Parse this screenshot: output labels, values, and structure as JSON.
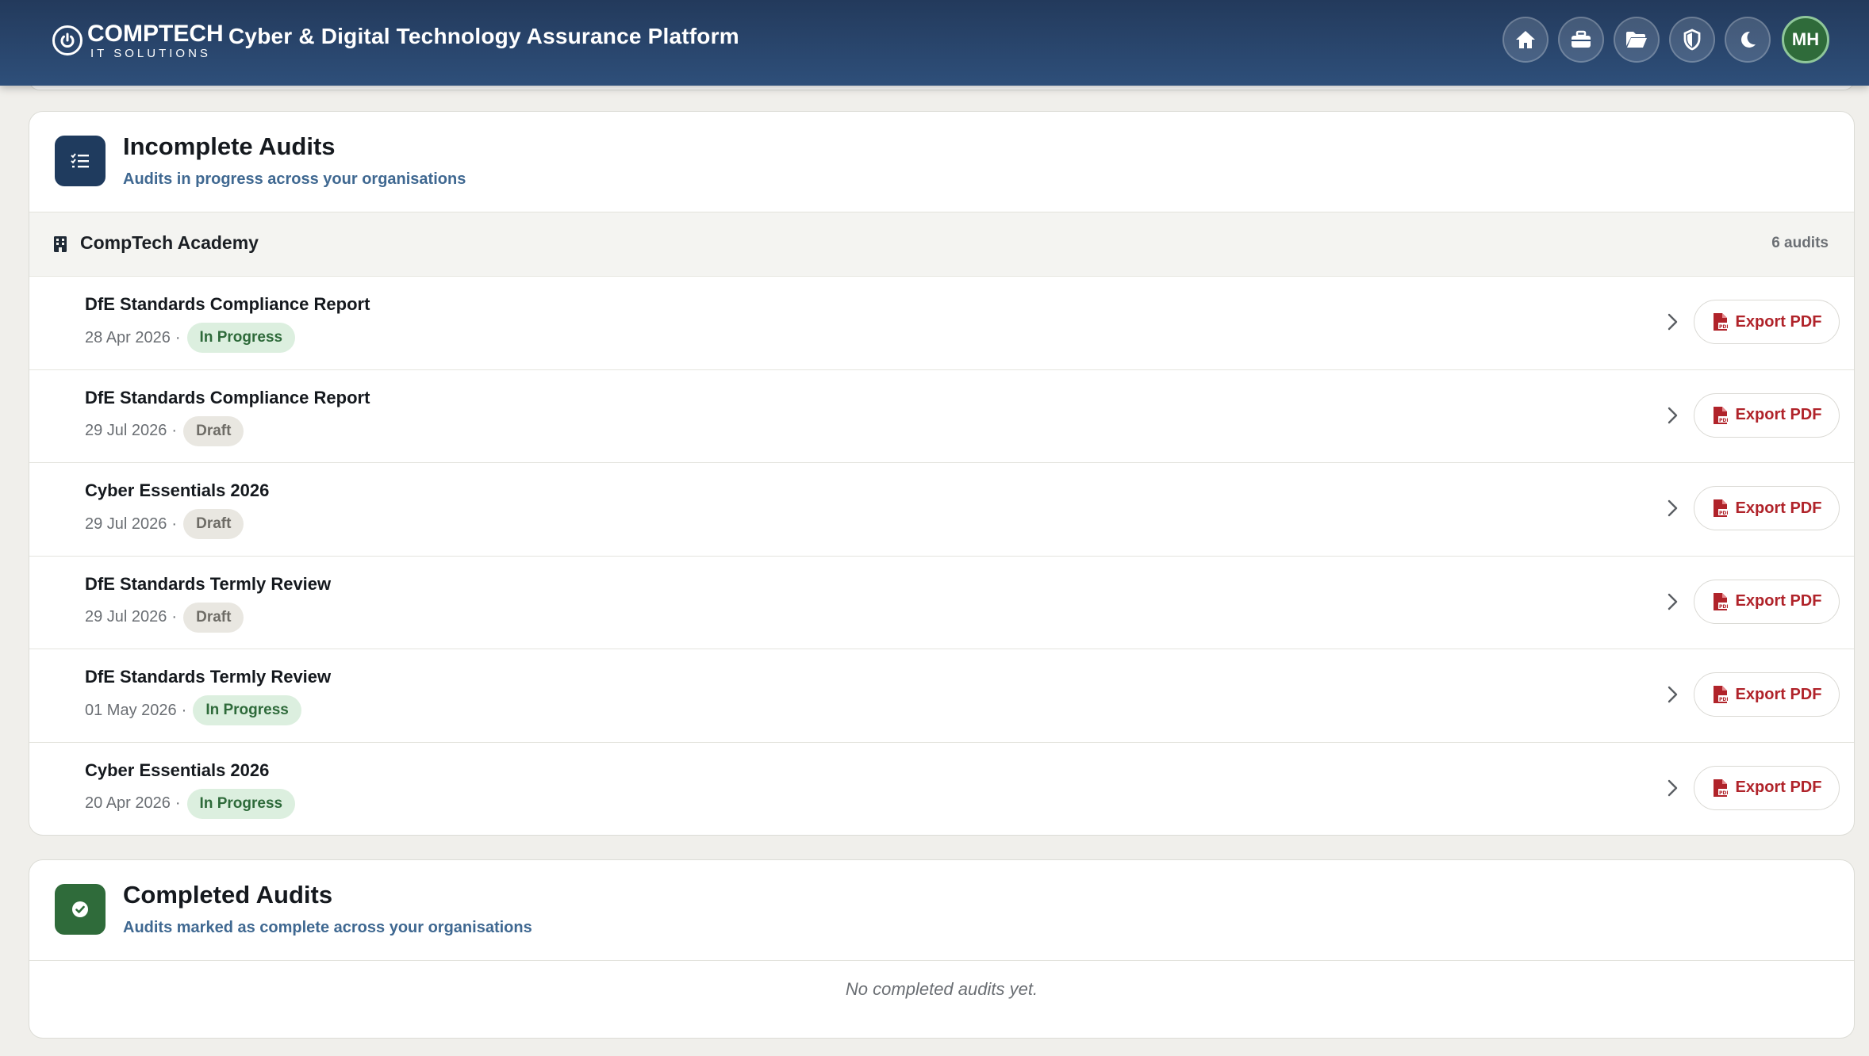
{
  "header": {
    "logo_main": "COMPTECH",
    "logo_sub": "IT SOLUTIONS",
    "title": "Cyber & Digital Technology Assurance Platform",
    "nav_icons": [
      "home-icon",
      "briefcase-icon",
      "folder-open-icon",
      "shield-icon",
      "moon-icon"
    ],
    "avatar_initials": "MH",
    "colors": {
      "bar": "#2b4a72",
      "avatar": "#2f6b3a"
    }
  },
  "incomplete": {
    "title": "Incomplete Audits",
    "subtitle": "Audits in progress across your organisations",
    "org": {
      "name": "CompTech Academy",
      "count": "6 audits"
    },
    "audits": [
      {
        "title": "DfE Standards Compliance Report",
        "date": "28 Apr 2026",
        "status": "In Progress"
      },
      {
        "title": "DfE Standards Compliance Report",
        "date": "29 Jul 2026",
        "status": "Draft"
      },
      {
        "title": "Cyber Essentials 2026",
        "date": "29 Jul 2026",
        "status": "Draft"
      },
      {
        "title": "DfE Standards Termly Review",
        "date": "29 Jul 2026",
        "status": "Draft"
      },
      {
        "title": "DfE Standards Termly Review",
        "date": "01 May 2026",
        "status": "In Progress"
      },
      {
        "title": "Cyber Essentials 2026",
        "date": "20 Apr 2026",
        "status": "In Progress"
      }
    ],
    "export_label": "Export PDF",
    "separator": "·"
  },
  "completed": {
    "title": "Completed Audits",
    "subtitle": "Audits marked as complete across your organisations",
    "empty_text": "No completed audits yet."
  },
  "status_colors": {
    "In Progress": "#dcefdf",
    "Draft": "#e9e7e1",
    "export": "#b0232a"
  }
}
